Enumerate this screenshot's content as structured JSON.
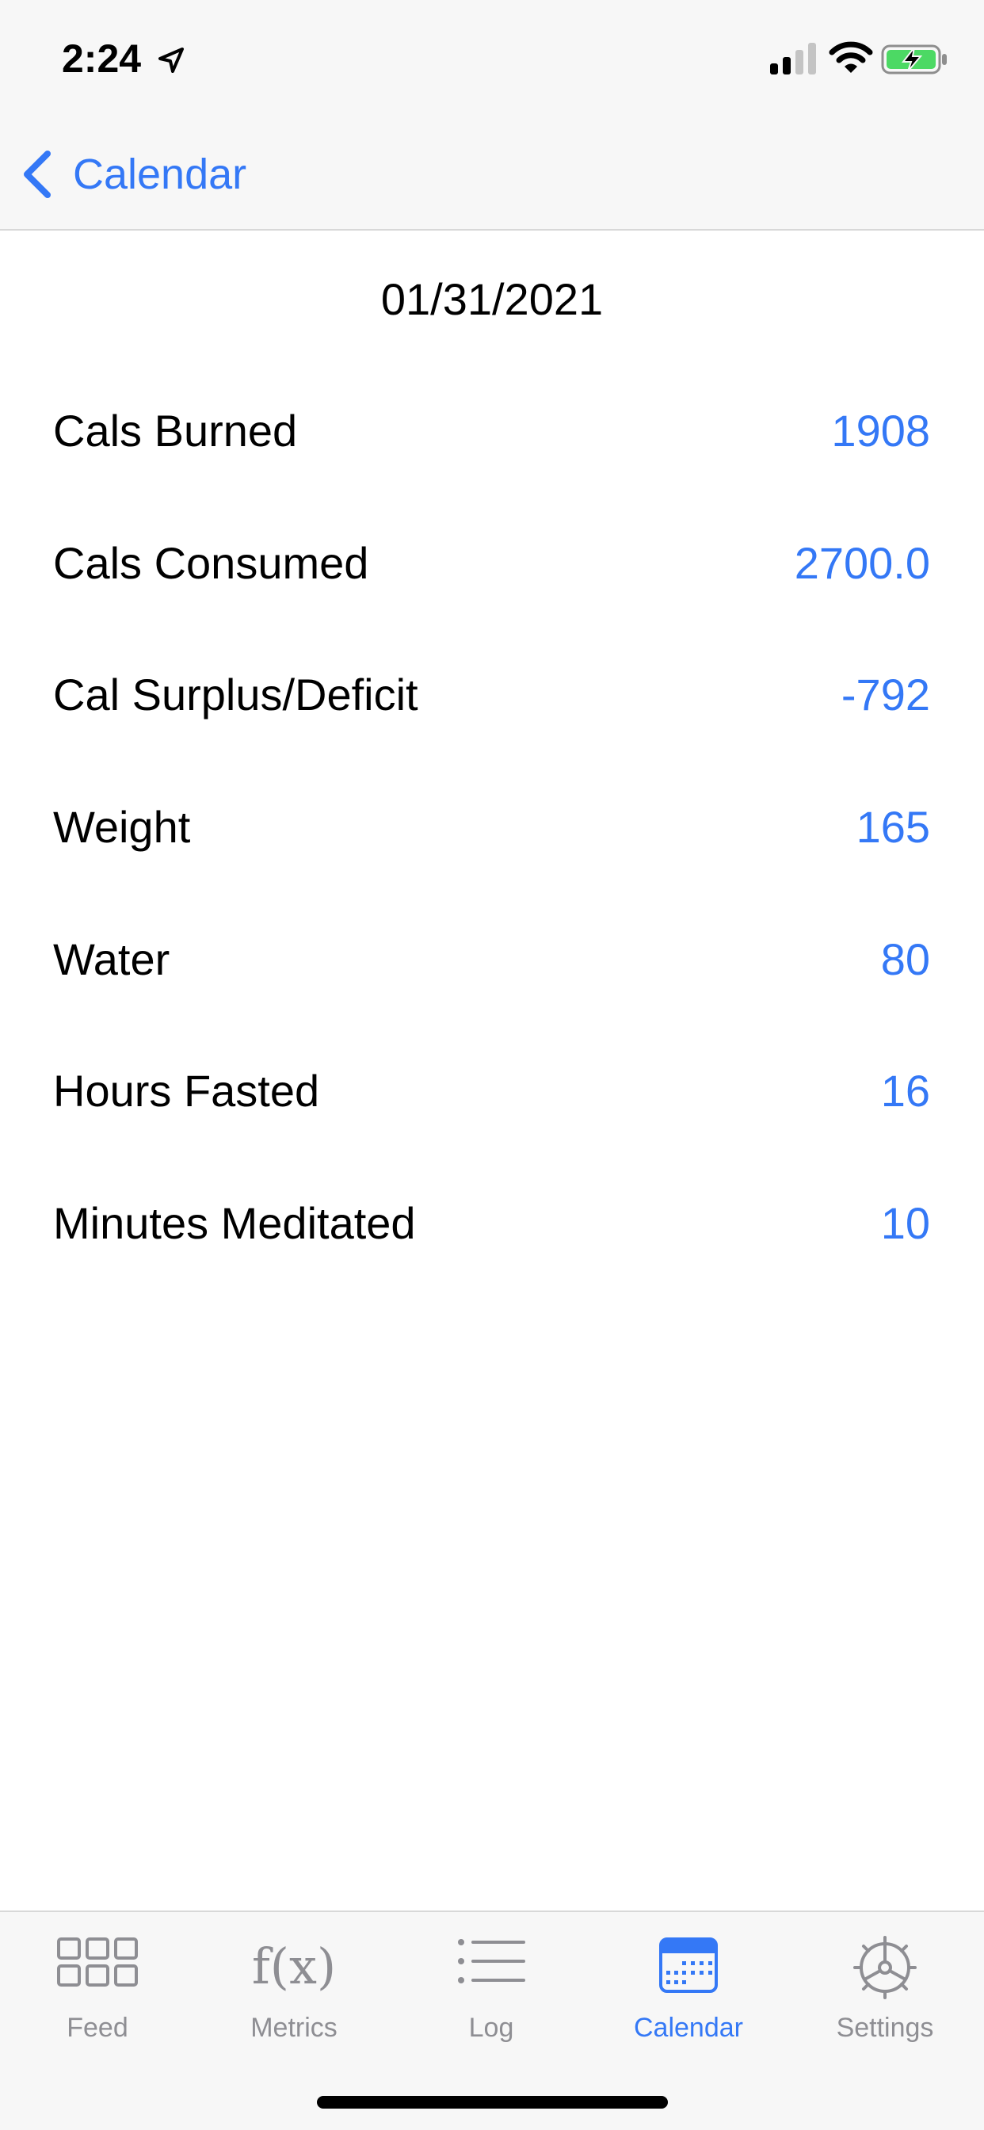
{
  "status_bar": {
    "time": "2:24",
    "icons": [
      "location-arrow-icon",
      "cellular-signal-icon",
      "wifi-icon",
      "battery-charging-icon"
    ]
  },
  "nav": {
    "back_label": "Calendar",
    "back_icon": "chevron-left-icon"
  },
  "page": {
    "date": "01/31/2021"
  },
  "metrics": [
    {
      "label": "Cals Burned",
      "value": "1908"
    },
    {
      "label": "Cals Consumed",
      "value": "2700.0"
    },
    {
      "label": "Cal Surplus/Deficit",
      "value": "-792"
    },
    {
      "label": "Weight",
      "value": "165"
    },
    {
      "label": "Water",
      "value": "80"
    },
    {
      "label": "Hours Fasted",
      "value": "16"
    },
    {
      "label": "Minutes Meditated",
      "value": "10"
    }
  ],
  "tab_bar": {
    "tabs": [
      {
        "label": "Feed",
        "icon": "grid-icon",
        "active": false
      },
      {
        "label": "Metrics",
        "icon": "function-icon",
        "glyph": "f(x)",
        "active": false
      },
      {
        "label": "Log",
        "icon": "list-icon",
        "active": false
      },
      {
        "label": "Calendar",
        "icon": "calendar-icon",
        "active": true
      },
      {
        "label": "Settings",
        "icon": "gear-icon",
        "active": false
      }
    ]
  },
  "colors": {
    "accent": "#3478f6",
    "inactive": "#8e8e93",
    "bar_background": "#f7f7f7",
    "battery_green": "#4cd964"
  }
}
